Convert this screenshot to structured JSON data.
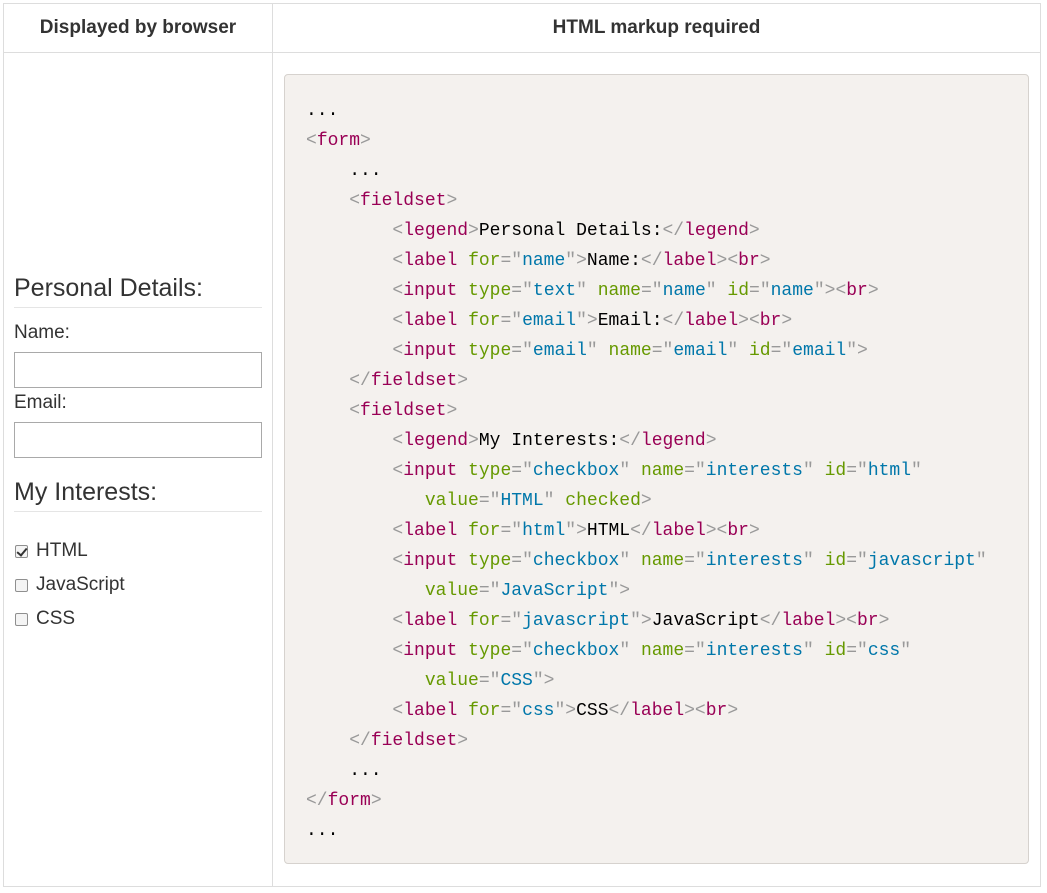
{
  "table": {
    "col_left_header": "Displayed by browser",
    "col_right_header": "HTML markup required"
  },
  "demo_form": {
    "fieldset1": {
      "legend": "Personal Details:",
      "name_label": "Name:",
      "name_value": "",
      "email_label": "Email:",
      "email_value": ""
    },
    "fieldset2": {
      "legend": "My Interests:",
      "options": [
        {
          "label": "HTML",
          "checked": true
        },
        {
          "label": "JavaScript",
          "checked": false
        },
        {
          "label": "CSS",
          "checked": false
        }
      ]
    }
  },
  "code_lines": [
    [
      {
        "t": "x",
        "s": "..."
      }
    ],
    [
      {
        "t": "p",
        "s": "<"
      },
      {
        "t": "t",
        "s": "form"
      },
      {
        "t": "p",
        "s": ">"
      }
    ],
    [
      {
        "t": "x",
        "s": "    ..."
      }
    ],
    [
      {
        "t": "x",
        "s": "    "
      },
      {
        "t": "p",
        "s": "<"
      },
      {
        "t": "t",
        "s": "fieldset"
      },
      {
        "t": "p",
        "s": ">"
      }
    ],
    [
      {
        "t": "x",
        "s": "        "
      },
      {
        "t": "p",
        "s": "<"
      },
      {
        "t": "t",
        "s": "legend"
      },
      {
        "t": "p",
        "s": ">"
      },
      {
        "t": "x",
        "s": "Personal Details:"
      },
      {
        "t": "p",
        "s": "</"
      },
      {
        "t": "t",
        "s": "legend"
      },
      {
        "t": "p",
        "s": ">"
      }
    ],
    [
      {
        "t": "x",
        "s": "        "
      },
      {
        "t": "p",
        "s": "<"
      },
      {
        "t": "t",
        "s": "label"
      },
      {
        "t": "x",
        "s": " "
      },
      {
        "t": "a",
        "s": "for"
      },
      {
        "t": "p",
        "s": "=\""
      },
      {
        "t": "v",
        "s": "name"
      },
      {
        "t": "p",
        "s": "\">"
      },
      {
        "t": "x",
        "s": "Name:"
      },
      {
        "t": "p",
        "s": "</"
      },
      {
        "t": "t",
        "s": "label"
      },
      {
        "t": "p",
        "s": "><"
      },
      {
        "t": "t",
        "s": "br"
      },
      {
        "t": "p",
        "s": ">"
      }
    ],
    [
      {
        "t": "x",
        "s": "        "
      },
      {
        "t": "p",
        "s": "<"
      },
      {
        "t": "t",
        "s": "input"
      },
      {
        "t": "x",
        "s": " "
      },
      {
        "t": "a",
        "s": "type"
      },
      {
        "t": "p",
        "s": "=\""
      },
      {
        "t": "v",
        "s": "text"
      },
      {
        "t": "p",
        "s": "\""
      },
      {
        "t": "x",
        "s": " "
      },
      {
        "t": "a",
        "s": "name"
      },
      {
        "t": "p",
        "s": "=\""
      },
      {
        "t": "v",
        "s": "name"
      },
      {
        "t": "p",
        "s": "\""
      },
      {
        "t": "x",
        "s": " "
      },
      {
        "t": "a",
        "s": "id"
      },
      {
        "t": "p",
        "s": "=\""
      },
      {
        "t": "v",
        "s": "name"
      },
      {
        "t": "p",
        "s": "\"><"
      },
      {
        "t": "t",
        "s": "br"
      },
      {
        "t": "p",
        "s": ">"
      }
    ],
    [
      {
        "t": "x",
        "s": "        "
      },
      {
        "t": "p",
        "s": "<"
      },
      {
        "t": "t",
        "s": "label"
      },
      {
        "t": "x",
        "s": " "
      },
      {
        "t": "a",
        "s": "for"
      },
      {
        "t": "p",
        "s": "=\""
      },
      {
        "t": "v",
        "s": "email"
      },
      {
        "t": "p",
        "s": "\">"
      },
      {
        "t": "x",
        "s": "Email:"
      },
      {
        "t": "p",
        "s": "</"
      },
      {
        "t": "t",
        "s": "label"
      },
      {
        "t": "p",
        "s": "><"
      },
      {
        "t": "t",
        "s": "br"
      },
      {
        "t": "p",
        "s": ">"
      }
    ],
    [
      {
        "t": "x",
        "s": "        "
      },
      {
        "t": "p",
        "s": "<"
      },
      {
        "t": "t",
        "s": "input"
      },
      {
        "t": "x",
        "s": " "
      },
      {
        "t": "a",
        "s": "type"
      },
      {
        "t": "p",
        "s": "=\""
      },
      {
        "t": "v",
        "s": "email"
      },
      {
        "t": "p",
        "s": "\""
      },
      {
        "t": "x",
        "s": " "
      },
      {
        "t": "a",
        "s": "name"
      },
      {
        "t": "p",
        "s": "=\""
      },
      {
        "t": "v",
        "s": "email"
      },
      {
        "t": "p",
        "s": "\""
      },
      {
        "t": "x",
        "s": " "
      },
      {
        "t": "a",
        "s": "id"
      },
      {
        "t": "p",
        "s": "=\""
      },
      {
        "t": "v",
        "s": "email"
      },
      {
        "t": "p",
        "s": "\">"
      }
    ],
    [
      {
        "t": "x",
        "s": "    "
      },
      {
        "t": "p",
        "s": "</"
      },
      {
        "t": "t",
        "s": "fieldset"
      },
      {
        "t": "p",
        "s": ">"
      }
    ],
    [
      {
        "t": "x",
        "s": "    "
      },
      {
        "t": "p",
        "s": "<"
      },
      {
        "t": "t",
        "s": "fieldset"
      },
      {
        "t": "p",
        "s": ">"
      }
    ],
    [
      {
        "t": "x",
        "s": "        "
      },
      {
        "t": "p",
        "s": "<"
      },
      {
        "t": "t",
        "s": "legend"
      },
      {
        "t": "p",
        "s": ">"
      },
      {
        "t": "x",
        "s": "My Interests:"
      },
      {
        "t": "p",
        "s": "</"
      },
      {
        "t": "t",
        "s": "legend"
      },
      {
        "t": "p",
        "s": ">"
      }
    ],
    [
      {
        "t": "x",
        "s": "        "
      },
      {
        "t": "p",
        "s": "<"
      },
      {
        "t": "t",
        "s": "input"
      },
      {
        "t": "x",
        "s": " "
      },
      {
        "t": "a",
        "s": "type"
      },
      {
        "t": "p",
        "s": "=\""
      },
      {
        "t": "v",
        "s": "checkbox"
      },
      {
        "t": "p",
        "s": "\""
      },
      {
        "t": "x",
        "s": " "
      },
      {
        "t": "a",
        "s": "name"
      },
      {
        "t": "p",
        "s": "=\""
      },
      {
        "t": "v",
        "s": "interests"
      },
      {
        "t": "p",
        "s": "\""
      },
      {
        "t": "x",
        "s": " "
      },
      {
        "t": "a",
        "s": "id"
      },
      {
        "t": "p",
        "s": "=\""
      },
      {
        "t": "v",
        "s": "html"
      },
      {
        "t": "p",
        "s": "\""
      }
    ],
    [
      {
        "t": "x",
        "s": "           "
      },
      {
        "t": "a",
        "s": "value"
      },
      {
        "t": "p",
        "s": "=\""
      },
      {
        "t": "v",
        "s": "HTML"
      },
      {
        "t": "p",
        "s": "\""
      },
      {
        "t": "x",
        "s": " "
      },
      {
        "t": "a",
        "s": "checked"
      },
      {
        "t": "p",
        "s": ">"
      }
    ],
    [
      {
        "t": "x",
        "s": "        "
      },
      {
        "t": "p",
        "s": "<"
      },
      {
        "t": "t",
        "s": "label"
      },
      {
        "t": "x",
        "s": " "
      },
      {
        "t": "a",
        "s": "for"
      },
      {
        "t": "p",
        "s": "=\""
      },
      {
        "t": "v",
        "s": "html"
      },
      {
        "t": "p",
        "s": "\">"
      },
      {
        "t": "x",
        "s": "HTML"
      },
      {
        "t": "p",
        "s": "</"
      },
      {
        "t": "t",
        "s": "label"
      },
      {
        "t": "p",
        "s": "><"
      },
      {
        "t": "t",
        "s": "br"
      },
      {
        "t": "p",
        "s": ">"
      }
    ],
    [
      {
        "t": "x",
        "s": "        "
      },
      {
        "t": "p",
        "s": "<"
      },
      {
        "t": "t",
        "s": "input"
      },
      {
        "t": "x",
        "s": " "
      },
      {
        "t": "a",
        "s": "type"
      },
      {
        "t": "p",
        "s": "=\""
      },
      {
        "t": "v",
        "s": "checkbox"
      },
      {
        "t": "p",
        "s": "\""
      },
      {
        "t": "x",
        "s": " "
      },
      {
        "t": "a",
        "s": "name"
      },
      {
        "t": "p",
        "s": "=\""
      },
      {
        "t": "v",
        "s": "interests"
      },
      {
        "t": "p",
        "s": "\""
      },
      {
        "t": "x",
        "s": " "
      },
      {
        "t": "a",
        "s": "id"
      },
      {
        "t": "p",
        "s": "=\""
      },
      {
        "t": "v",
        "s": "javascript"
      },
      {
        "t": "p",
        "s": "\""
      }
    ],
    [
      {
        "t": "x",
        "s": "           "
      },
      {
        "t": "a",
        "s": "value"
      },
      {
        "t": "p",
        "s": "=\""
      },
      {
        "t": "v",
        "s": "JavaScript"
      },
      {
        "t": "p",
        "s": "\">"
      }
    ],
    [
      {
        "t": "x",
        "s": "        "
      },
      {
        "t": "p",
        "s": "<"
      },
      {
        "t": "t",
        "s": "label"
      },
      {
        "t": "x",
        "s": " "
      },
      {
        "t": "a",
        "s": "for"
      },
      {
        "t": "p",
        "s": "=\""
      },
      {
        "t": "v",
        "s": "javascript"
      },
      {
        "t": "p",
        "s": "\">"
      },
      {
        "t": "x",
        "s": "JavaScript"
      },
      {
        "t": "p",
        "s": "</"
      },
      {
        "t": "t",
        "s": "label"
      },
      {
        "t": "p",
        "s": "><"
      },
      {
        "t": "t",
        "s": "br"
      },
      {
        "t": "p",
        "s": ">"
      }
    ],
    [
      {
        "t": "x",
        "s": "        "
      },
      {
        "t": "p",
        "s": "<"
      },
      {
        "t": "t",
        "s": "input"
      },
      {
        "t": "x",
        "s": " "
      },
      {
        "t": "a",
        "s": "type"
      },
      {
        "t": "p",
        "s": "=\""
      },
      {
        "t": "v",
        "s": "checkbox"
      },
      {
        "t": "p",
        "s": "\""
      },
      {
        "t": "x",
        "s": " "
      },
      {
        "t": "a",
        "s": "name"
      },
      {
        "t": "p",
        "s": "=\""
      },
      {
        "t": "v",
        "s": "interests"
      },
      {
        "t": "p",
        "s": "\""
      },
      {
        "t": "x",
        "s": " "
      },
      {
        "t": "a",
        "s": "id"
      },
      {
        "t": "p",
        "s": "=\""
      },
      {
        "t": "v",
        "s": "css"
      },
      {
        "t": "p",
        "s": "\""
      }
    ],
    [
      {
        "t": "x",
        "s": "           "
      },
      {
        "t": "a",
        "s": "value"
      },
      {
        "t": "p",
        "s": "=\""
      },
      {
        "t": "v",
        "s": "CSS"
      },
      {
        "t": "p",
        "s": "\">"
      }
    ],
    [
      {
        "t": "x",
        "s": "        "
      },
      {
        "t": "p",
        "s": "<"
      },
      {
        "t": "t",
        "s": "label"
      },
      {
        "t": "x",
        "s": " "
      },
      {
        "t": "a",
        "s": "for"
      },
      {
        "t": "p",
        "s": "=\""
      },
      {
        "t": "v",
        "s": "css"
      },
      {
        "t": "p",
        "s": "\">"
      },
      {
        "t": "x",
        "s": "CSS"
      },
      {
        "t": "p",
        "s": "</"
      },
      {
        "t": "t",
        "s": "label"
      },
      {
        "t": "p",
        "s": "><"
      },
      {
        "t": "t",
        "s": "br"
      },
      {
        "t": "p",
        "s": ">"
      }
    ],
    [
      {
        "t": "x",
        "s": "    "
      },
      {
        "t": "p",
        "s": "</"
      },
      {
        "t": "t",
        "s": "fieldset"
      },
      {
        "t": "p",
        "s": ">"
      }
    ],
    [
      {
        "t": "x",
        "s": "    ..."
      }
    ],
    [
      {
        "t": "p",
        "s": "</"
      },
      {
        "t": "t",
        "s": "form"
      },
      {
        "t": "p",
        "s": ">"
      }
    ],
    [
      {
        "t": "x",
        "s": "..."
      }
    ]
  ],
  "syntax_colors": {
    "punctuation": "#999999",
    "tag": "#990055",
    "attr_name": "#669900",
    "attr_value": "#0077aa",
    "text": "#000000",
    "code_background": "#f4f1ee"
  }
}
